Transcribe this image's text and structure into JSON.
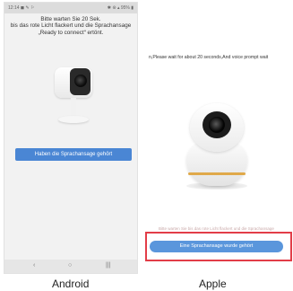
{
  "android": {
    "status_left": "12:14 ◼ ✎ ⚐",
    "status_right": "✱ ⊛ ▴ 95% ▮",
    "instructions": [
      "Bitte warten Sie 20 Sek.",
      "bis das rote Licht flackert und die Sprachansage",
      "„Ready to connect“ ertönt."
    ],
    "button_label": "Haben die Sprachansage gehört",
    "nav_back": "‹",
    "nav_home": "○",
    "nav_recent": "|||",
    "caption": "Android"
  },
  "apple": {
    "instructions": "n,Please wait for about 20 seconds,And voice prompt wait",
    "faded_text": "Bitte warten Sie bis das rote Licht flackert und die Sprachansage",
    "button_label": "Eine Sprachansage wurde gehört",
    "caption": "Apple"
  },
  "colors": {
    "button_blue": "#4a86d4",
    "highlight_red": "#e23d48"
  }
}
